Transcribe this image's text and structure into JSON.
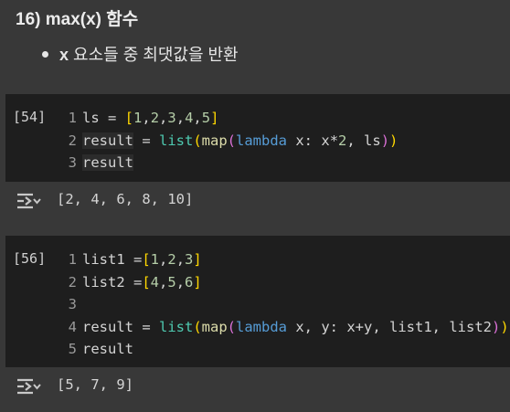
{
  "markdown": {
    "heading": "16) max(x) 함수",
    "bullet_x": "x",
    "bullet_text": " 요소들 중 최댓값을 반환"
  },
  "cells": [
    {
      "exec_count": "[54]",
      "lines": [
        {
          "no": "1",
          "tokens": [
            [
              "t-var",
              "ls"
            ],
            [
              "t-plain",
              " = "
            ],
            [
              "t-br1",
              "["
            ],
            [
              "t-num",
              "1"
            ],
            [
              "t-plain",
              ","
            ],
            [
              "t-num",
              "2"
            ],
            [
              "t-plain",
              ","
            ],
            [
              "t-num",
              "3"
            ],
            [
              "t-plain",
              ","
            ],
            [
              "t-num",
              "4"
            ],
            [
              "t-plain",
              ","
            ],
            [
              "t-num",
              "5"
            ],
            [
              "t-br1",
              "]"
            ]
          ]
        },
        {
          "no": "2",
          "tokens": [
            [
              "t-var hl",
              "result"
            ],
            [
              "t-plain",
              " = "
            ],
            [
              "t-builtin",
              "list"
            ],
            [
              "t-br1",
              "("
            ],
            [
              "t-func",
              "map"
            ],
            [
              "t-br2",
              "("
            ],
            [
              "t-kw",
              "lambda"
            ],
            [
              "t-plain",
              " x: x"
            ],
            [
              "t-plain",
              "*"
            ],
            [
              "t-num",
              "2"
            ],
            [
              "t-plain",
              ", ls"
            ],
            [
              "t-br2",
              ")"
            ],
            [
              "t-br1",
              ")"
            ]
          ]
        },
        {
          "no": "3",
          "tokens": [
            [
              "t-var hl",
              "result"
            ]
          ]
        }
      ],
      "output": "[2, 4, 6, 8, 10]"
    },
    {
      "exec_count": "[56]",
      "lines": [
        {
          "no": "1",
          "tokens": [
            [
              "t-var",
              "list1 ="
            ],
            [
              "t-br1",
              "["
            ],
            [
              "t-num",
              "1"
            ],
            [
              "t-plain",
              ","
            ],
            [
              "t-num",
              "2"
            ],
            [
              "t-plain",
              ","
            ],
            [
              "t-num",
              "3"
            ],
            [
              "t-br1",
              "]"
            ]
          ]
        },
        {
          "no": "2",
          "tokens": [
            [
              "t-var",
              "list2 ="
            ],
            [
              "t-br1",
              "["
            ],
            [
              "t-num",
              "4"
            ],
            [
              "t-plain",
              ","
            ],
            [
              "t-num",
              "5"
            ],
            [
              "t-plain",
              ","
            ],
            [
              "t-num",
              "6"
            ],
            [
              "t-br1",
              "]"
            ]
          ]
        },
        {
          "no": "3",
          "tokens": []
        },
        {
          "no": "4",
          "tokens": [
            [
              "t-var",
              "result"
            ],
            [
              "t-plain",
              " = "
            ],
            [
              "t-builtin",
              "list"
            ],
            [
              "t-br1",
              "("
            ],
            [
              "t-func",
              "map"
            ],
            [
              "t-br2",
              "("
            ],
            [
              "t-kw",
              "lambda"
            ],
            [
              "t-plain",
              " x, y: x+y, list1, list2"
            ],
            [
              "t-br2",
              ")"
            ],
            [
              "t-br1",
              ")"
            ]
          ]
        },
        {
          "no": "5",
          "tokens": [
            [
              "t-var",
              "result"
            ]
          ]
        }
      ],
      "output": "[5, 7, 9]"
    }
  ],
  "icons": {
    "output_toggle": "output-toggle-icon"
  }
}
